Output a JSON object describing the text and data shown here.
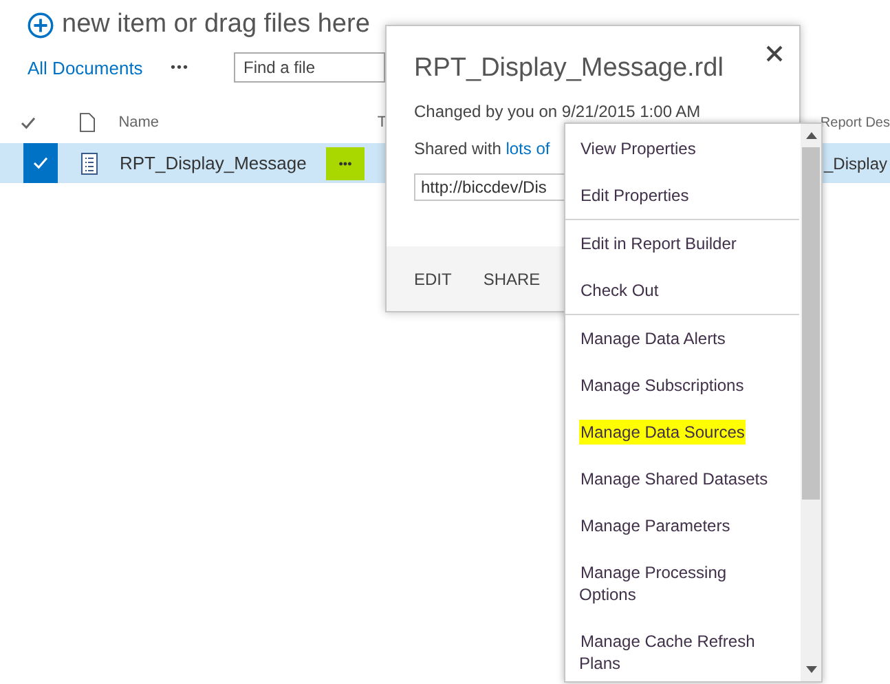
{
  "toolbar": {
    "new_item": "new item or drag files here"
  },
  "view_bar": {
    "view": "All Documents",
    "more": "•••",
    "search": {
      "placeholder": "Find a file"
    }
  },
  "columns": [
    {
      "kind": "check"
    },
    {
      "kind": "file"
    },
    {
      "kind": "text",
      "label": "Name"
    },
    {
      "kind": "text",
      "label": "T"
    },
    {
      "kind": "text",
      "label": "Report Des"
    }
  ],
  "rows": [
    {
      "selected": true,
      "name": "RPT_Display_Message",
      "more": {
        "label": "•••",
        "highlighted": true
      },
      "column_5": "_Display"
    }
  ],
  "callout": {
    "title": "RPT_Display_Message.rdl",
    "changed": "Changed by you on 9/21/2015 1:00 AM",
    "shared_prefix": "Shared with",
    "shared_link": "lots of",
    "url": "http://biccdev/Dis",
    "actions": [
      "EDIT",
      "SHARE"
    ]
  },
  "menu": {
    "groups": [
      [
        {
          "label": "View Properties",
          "highlighted": false
        },
        {
          "label": "Edit Properties",
          "highlighted": false
        }
      ],
      [
        {
          "label": "Edit in Report Builder",
          "highlighted": false
        },
        {
          "label": "Check Out",
          "highlighted": false
        }
      ],
      [
        {
          "label": "Manage Data Alerts",
          "highlighted": false
        },
        {
          "label": "Manage Subscriptions",
          "highlighted": false
        },
        {
          "label": "Manage Data Sources",
          "highlighted": true
        },
        {
          "label": "Manage Shared Datasets",
          "highlighted": false
        },
        {
          "label": "Manage Parameters",
          "highlighted": false
        },
        {
          "label": "Manage Processing Options",
          "highlighted": false
        },
        {
          "label": "Manage Cache Refresh Plans",
          "highlighted": false
        }
      ]
    ]
  }
}
